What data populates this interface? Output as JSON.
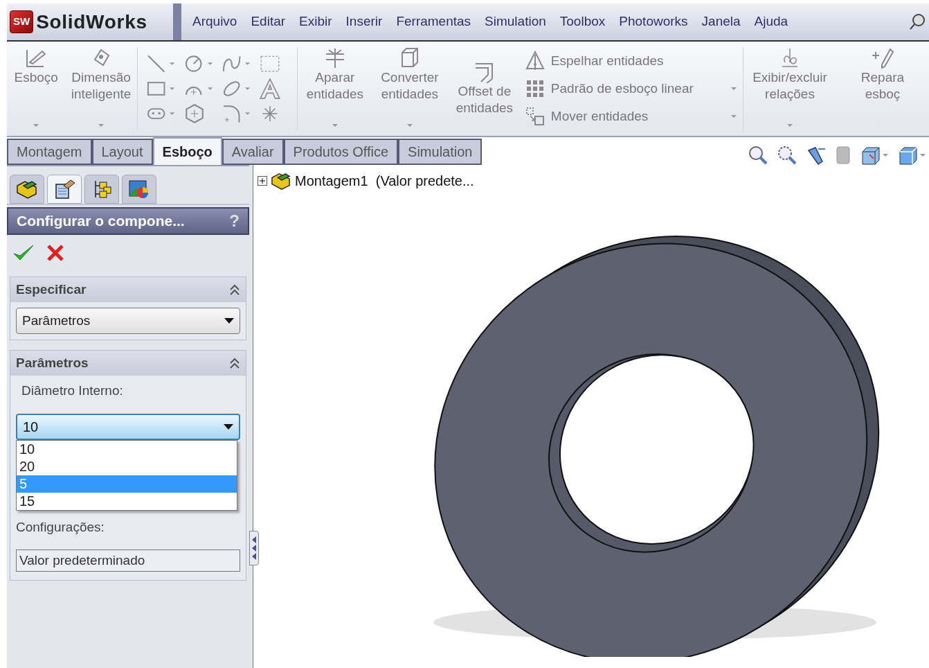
{
  "app": {
    "logo_badge": "SW",
    "logo_text": "SolidWorks"
  },
  "menu": [
    "Arquivo",
    "Editar",
    "Exibir",
    "Inserir",
    "Ferramentas",
    "Simulation",
    "Toolbox",
    "Photoworks",
    "Janela",
    "Ajuda"
  ],
  "toolbar": {
    "large_buttons": [
      {
        "label": "Esboço"
      },
      {
        "label": "Dimensão inteligente"
      }
    ],
    "entity_buttons": [
      {
        "label": "Aparar entidades",
        "kind": "trim"
      },
      {
        "label": "Converter entidades",
        "kind": "convert"
      },
      {
        "label": "Offset de entidades",
        "kind": "offset"
      }
    ],
    "list_buttons": [
      {
        "label": "Espelhar entidades",
        "kind": "mirror"
      },
      {
        "label": "Padrão de esboço linear",
        "kind": "pattern"
      },
      {
        "label": "Mover entidades",
        "kind": "move"
      }
    ],
    "relation_buttons": [
      {
        "label": "Exibir/excluir relações",
        "kind": "relations"
      },
      {
        "label": "Repara esboç",
        "kind": "repair"
      }
    ]
  },
  "command_tabs": [
    {
      "label": "Montagem",
      "selected": false
    },
    {
      "label": "Layout",
      "selected": false
    },
    {
      "label": "Esboço",
      "selected": true
    },
    {
      "label": "Avaliar",
      "selected": false
    },
    {
      "label": "Produtos Office",
      "selected": false
    },
    {
      "label": "Simulation",
      "selected": false
    }
  ],
  "panel": {
    "tabs": [
      {
        "kind": "tree",
        "selected": false
      },
      {
        "kind": "properties",
        "selected": true
      },
      {
        "kind": "config",
        "selected": false
      },
      {
        "kind": "display",
        "selected": false
      }
    ],
    "title": "Configurar o compone...",
    "help": "?",
    "specify": {
      "title": "Especificar",
      "value": "Parâmetros"
    },
    "parameters": {
      "title": "Parâmetros",
      "diameter_label": "Diâmetro Interno:",
      "diameter_value": "10",
      "options": [
        {
          "label": "10",
          "selected": false
        },
        {
          "label": "20",
          "selected": false
        },
        {
          "label": "5",
          "selected": true
        },
        {
          "label": "15",
          "selected": false
        }
      ],
      "config_label": "Configurações:",
      "config_value": "Valor predeterminado"
    }
  },
  "tree": {
    "label": "Montagem1  (Valor predete...",
    "expanded": false
  }
}
